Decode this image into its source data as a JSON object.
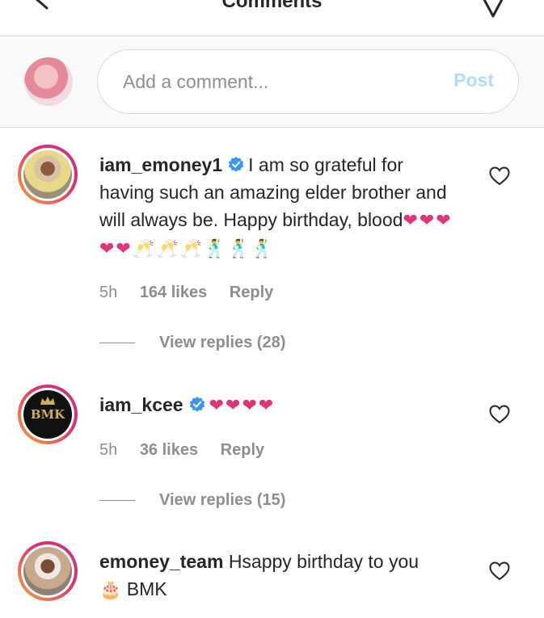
{
  "header": {
    "title": "Comments"
  },
  "composer": {
    "placeholder": "Add a comment...",
    "post_label": "Post"
  },
  "comments": [
    {
      "username": "iam_emoney1",
      "verified": true,
      "text": "I am so grateful for having such an amazing elder brother and will always be. Happy birthday, blood",
      "emojis": "❤❤❤❤❤🥂🥂🥂🕺🕺🕺",
      "time": "5h",
      "likes": "164 likes",
      "reply_label": "Reply",
      "view_replies": "View replies (28)"
    },
    {
      "username": "iam_kcee",
      "verified": true,
      "text": "",
      "emojis": "❤❤❤❤",
      "avatar_text": "BMK",
      "time": "5h",
      "likes": "36 likes",
      "reply_label": "Reply",
      "view_replies": "View replies (15)"
    },
    {
      "username": "emoney_team",
      "verified": false,
      "text": "Hsappy birthday to you",
      "emojis": "🎂",
      "text_after": "BMK"
    }
  ],
  "colors": {
    "verified_blue": "#3897f0",
    "heart_pink": "#e0337a",
    "post_disabled": "#b3dbff",
    "meta_grey": "#8e8e8e"
  },
  "icons": [
    "back-icon",
    "send-icon",
    "verified-icon",
    "heart-outline-icon"
  ]
}
